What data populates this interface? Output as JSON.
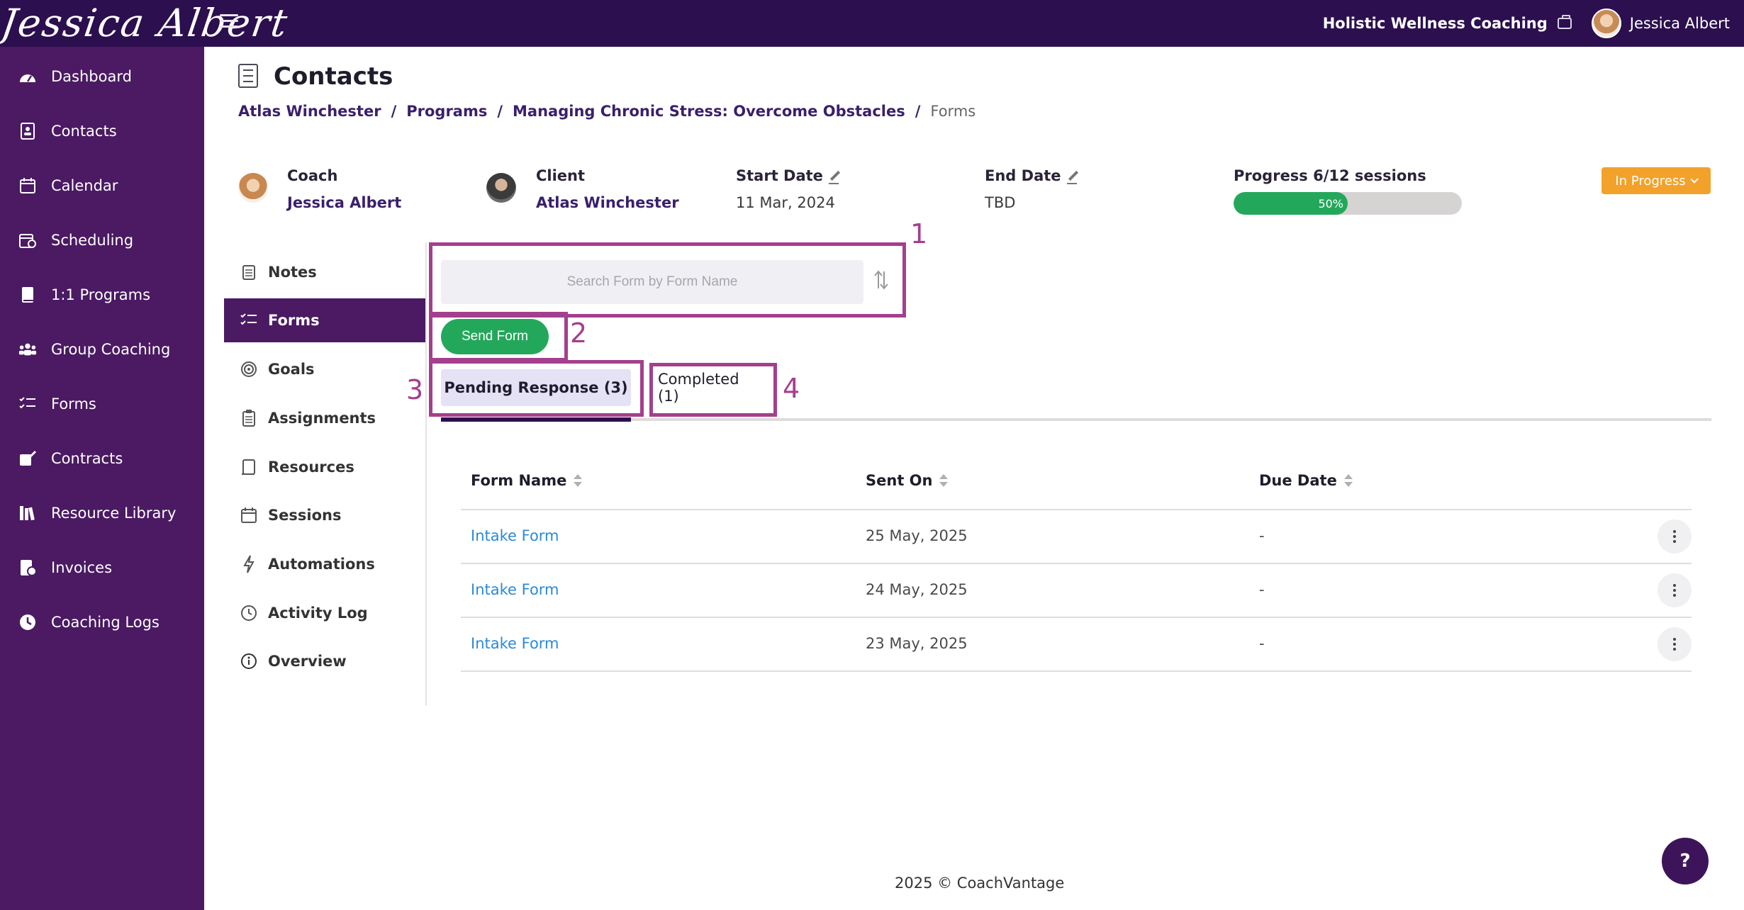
{
  "topbar": {
    "logo_text": "Jessica Albert",
    "org_name": "Holistic Wellness Coaching",
    "user_name": "Jessica Albert"
  },
  "sidebar": {
    "items": [
      {
        "label": "Dashboard",
        "icon": "dashboard-icon"
      },
      {
        "label": "Contacts",
        "icon": "contacts-icon"
      },
      {
        "label": "Calendar",
        "icon": "calendar-icon"
      },
      {
        "label": "Scheduling",
        "icon": "scheduling-icon"
      },
      {
        "label": "1:1 Programs",
        "icon": "book-icon"
      },
      {
        "label": "Group Coaching",
        "icon": "group-icon"
      },
      {
        "label": "Forms",
        "icon": "forms-icon"
      },
      {
        "label": "Contracts",
        "icon": "contracts-icon"
      },
      {
        "label": "Resource Library",
        "icon": "library-icon"
      },
      {
        "label": "Invoices",
        "icon": "invoice-icon"
      },
      {
        "label": "Coaching Logs",
        "icon": "clock-icon"
      }
    ]
  },
  "page": {
    "title": "Contacts",
    "breadcrumb": [
      "Atlas Winchester",
      "Programs",
      "Managing Chronic Stress: Overcome Obstacles",
      "Forms"
    ],
    "breadcrumb_sep": "/"
  },
  "info": {
    "coach_label": "Coach",
    "coach_name": "Jessica Albert",
    "client_label": "Client",
    "client_name": "Atlas Winchester",
    "start_label": "Start Date",
    "start_value": "11 Mar, 2024",
    "end_label": "End Date",
    "end_value": "TBD",
    "progress_label": "Progress 6/12 sessions",
    "progress_text": "50%",
    "progress_fraction": 0.5,
    "status": "In Progress"
  },
  "subnav": {
    "items": [
      {
        "label": "Notes",
        "icon": "notes-icon"
      },
      {
        "label": "Forms",
        "icon": "forms-list-icon",
        "active": true
      },
      {
        "label": "Goals",
        "icon": "target-icon"
      },
      {
        "label": "Assignments",
        "icon": "clipboard-icon"
      },
      {
        "label": "Resources",
        "icon": "resources-icon"
      },
      {
        "label": "Sessions",
        "icon": "sessions-icon"
      },
      {
        "label": "Automations",
        "icon": "bolt-icon"
      },
      {
        "label": "Activity Log",
        "icon": "history-icon"
      },
      {
        "label": "Overview",
        "icon": "info-icon"
      }
    ]
  },
  "forms": {
    "search_placeholder": "Search Form by Form Name",
    "send_button": "Send Form",
    "tab_pending": "Pending Response (3)",
    "tab_completed": "Completed (1)",
    "columns": [
      "Form Name",
      "Sent On",
      "Due Date"
    ],
    "rows": [
      {
        "name": "Intake Form",
        "sent_on": "25 May, 2025",
        "due": "-"
      },
      {
        "name": "Intake Form",
        "sent_on": "24 May, 2025",
        "due": "-"
      },
      {
        "name": "Intake Form",
        "sent_on": "23 May, 2025",
        "due": "-"
      }
    ]
  },
  "annotations": [
    "1",
    "2",
    "3",
    "4"
  ],
  "footer": {
    "text": "2025 © CoachVantage"
  },
  "help": {
    "label": "?"
  },
  "colors": {
    "topbar": "#2c0f4e",
    "sidebar": "#4b1a63",
    "accent_green": "#23a85b",
    "status_orange": "#f2a22a",
    "annotation": "#a43f8d",
    "link_blue": "#2a8ad6"
  }
}
